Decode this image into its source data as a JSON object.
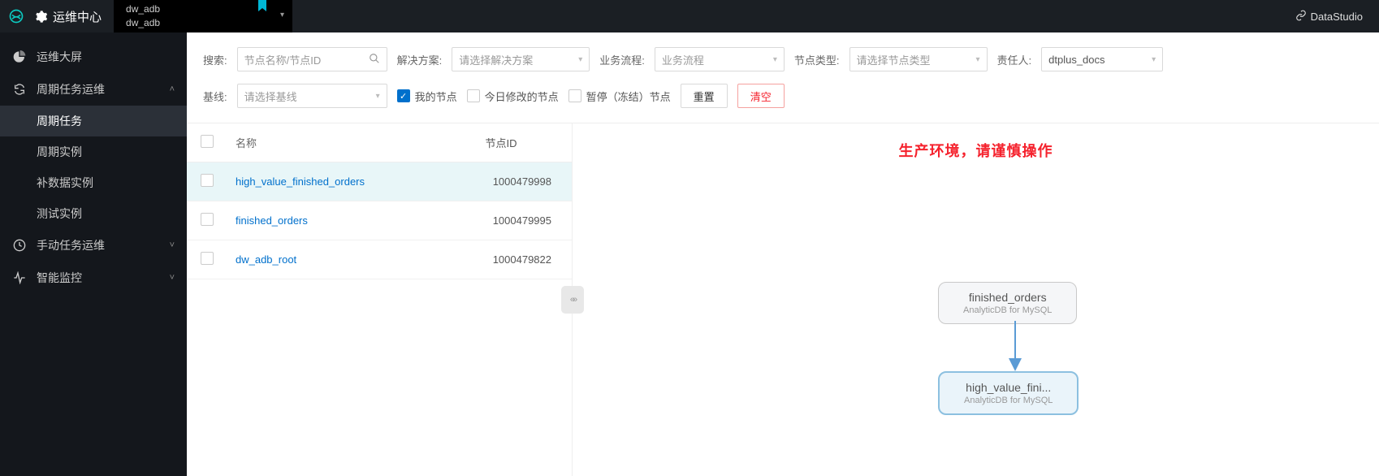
{
  "topbar": {
    "title": "运维中心",
    "tab_line1": "dw_adb",
    "tab_line2": "dw_adb",
    "datastudio": "DataStudio"
  },
  "sidebar": {
    "dashboard": "运维大屏",
    "cycle_ops": "周期任务运维",
    "cycle_tasks": "周期任务",
    "cycle_instances": "周期实例",
    "patch_instances": "补数据实例",
    "test_instances": "测试实例",
    "manual_ops": "手动任务运维",
    "smart_monitor": "智能监控"
  },
  "filters": {
    "search_label": "搜索:",
    "search_placeholder": "节点名称/节点ID",
    "solution_label": "解决方案:",
    "solution_placeholder": "请选择解决方案",
    "flow_label": "业务流程:",
    "flow_placeholder": "业务流程",
    "nodetype_label": "节点类型:",
    "nodetype_placeholder": "请选择节点类型",
    "owner_label": "责任人:",
    "owner_value": "dtplus_docs",
    "baseline_label": "基线:",
    "baseline_placeholder": "请选择基线",
    "my_nodes": "我的节点",
    "modified_today": "今日修改的节点",
    "paused_nodes": "暂停（冻结）节点",
    "reset_btn": "重置",
    "clear_btn": "清空"
  },
  "table": {
    "col_name": "名称",
    "col_id": "节点ID",
    "rows": [
      {
        "name": "high_value_finished_orders",
        "id": "1000479998",
        "selected": true
      },
      {
        "name": "finished_orders",
        "id": "1000479995",
        "selected": false
      },
      {
        "name": "dw_adb_root",
        "id": "1000479822",
        "selected": false
      }
    ]
  },
  "graph": {
    "warning": "生产环境，请谨慎操作",
    "node1_label": "finished_orders",
    "node1_sub": "AnalyticDB for MySQL",
    "node2_label": "high_value_fini...",
    "node2_sub": "AnalyticDB for MySQL"
  }
}
